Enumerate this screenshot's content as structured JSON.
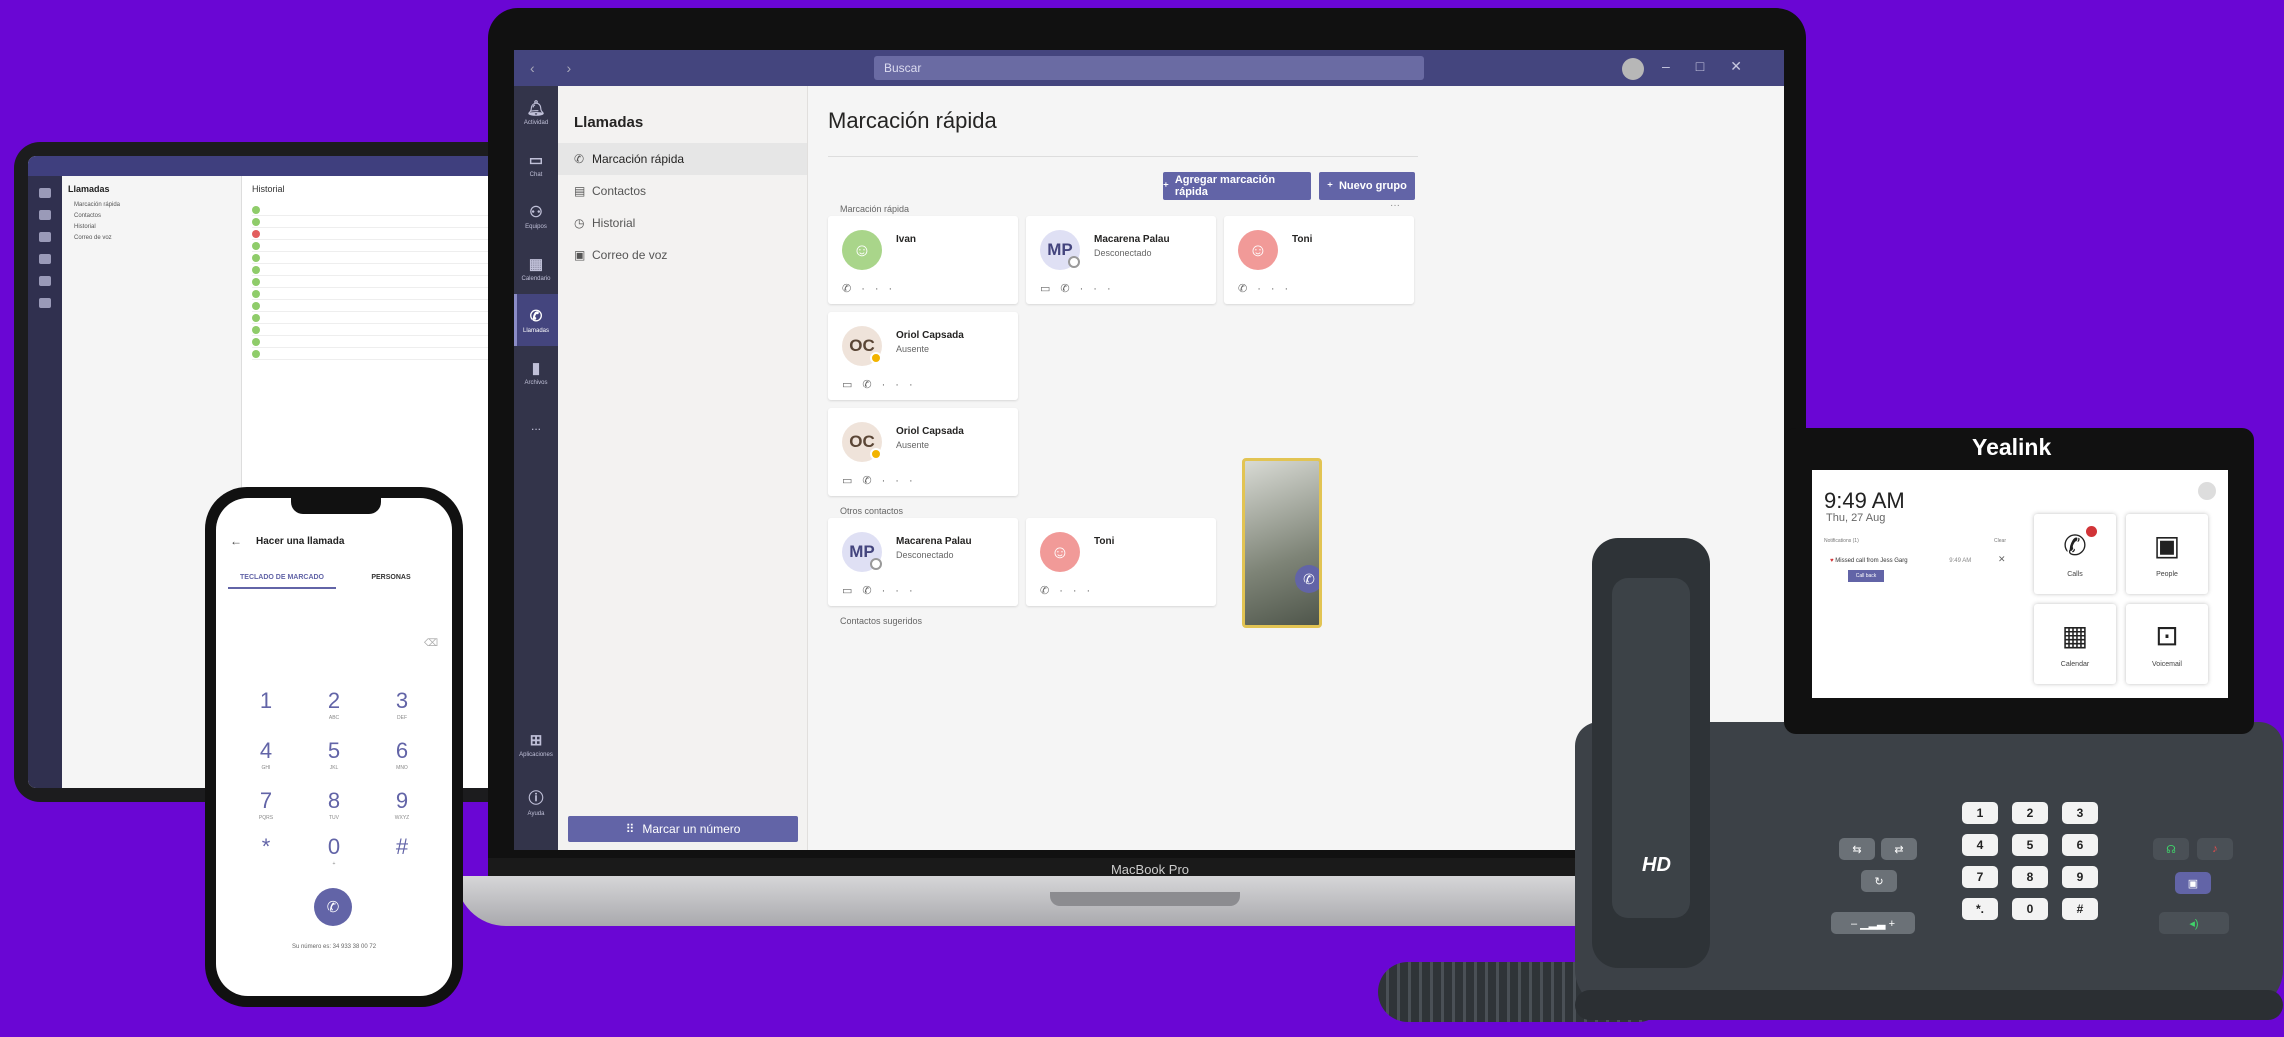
{
  "tablet": {
    "left_title": "Llamadas",
    "left_items": [
      "Marcación rápida",
      "Contactos",
      "Historial",
      "Correo de voz"
    ],
    "main_title": "Historial",
    "rows": 13
  },
  "laptop": {
    "search_placeholder": "Buscar",
    "model_label": "MacBook Pro",
    "rail": [
      {
        "label": "Actividad"
      },
      {
        "label": "Chat"
      },
      {
        "label": "Equipos"
      },
      {
        "label": "Calendario"
      },
      {
        "label": "Llamadas"
      },
      {
        "label": "Archivos"
      },
      {
        "label": "..."
      },
      {
        "label": "Aplicaciones"
      },
      {
        "label": "Ayuda"
      }
    ],
    "left_title": "Llamadas",
    "left_items": [
      {
        "icon": "✆",
        "label": "Marcación rápida"
      },
      {
        "icon": "▤",
        "label": "Contactos"
      },
      {
        "icon": "◷",
        "label": "Historial"
      },
      {
        "icon": "▣",
        "label": "Correo de voz"
      }
    ],
    "dial_button": "Marcar un número",
    "main_title": "Marcación rápida",
    "add_speed_dial": "Agregar marcación rápida",
    "new_group": "Nuevo grupo",
    "section_speed": "Marcación rápida",
    "section_others": "Otros contactos",
    "section_suggested": "Contactos sugeridos",
    "cards": [
      {
        "name": "Ivan",
        "status": "",
        "initials": ""
      },
      {
        "name": "Macarena Palau",
        "status": "Desconectado",
        "initials": "MP"
      },
      {
        "name": "Toni",
        "status": "",
        "initials": ""
      },
      {
        "name": "Oriol Capsada",
        "status": "Ausente",
        "initials": "OC"
      },
      {
        "name": "Oriol Capsada",
        "status": "Ausente",
        "initials": "OC"
      },
      {
        "name": "Macarena Palau",
        "status": "Desconectado",
        "initials": "MP"
      },
      {
        "name": "Toni",
        "status": "",
        "initials": ""
      }
    ]
  },
  "phone": {
    "title": "Hacer una llamada",
    "tab_a": "TECLADO DE MARCADO",
    "tab_b": "PERSONAS",
    "keys": [
      {
        "d": "1",
        "s": ""
      },
      {
        "d": "2",
        "s": "ABC"
      },
      {
        "d": "3",
        "s": "DEF"
      },
      {
        "d": "4",
        "s": "GHI"
      },
      {
        "d": "5",
        "s": "JKL"
      },
      {
        "d": "6",
        "s": "MNO"
      },
      {
        "d": "7",
        "s": "PQRS"
      },
      {
        "d": "8",
        "s": "TUV"
      },
      {
        "d": "9",
        "s": "WXYZ"
      },
      {
        "d": "*",
        "s": ""
      },
      {
        "d": "0",
        "s": "+"
      },
      {
        "d": "#",
        "s": ""
      }
    ],
    "footer": "Su número es: 34 933 38 00 72"
  },
  "desk": {
    "brand": "Yealink",
    "hd": "HD",
    "time": "9:49 AM",
    "date": "Thu, 27 Aug",
    "notif": "Notifications (1)",
    "notif_clear": "Clear",
    "missed": "Missed call from Jess Garg",
    "missed_time": "9:49 AM",
    "callback": "Call back",
    "tiles": [
      {
        "g": "✆",
        "label": "Calls"
      },
      {
        "g": "▣",
        "label": "People"
      },
      {
        "g": "▦",
        "label": "Calendar"
      },
      {
        "g": "⊡",
        "label": "Voicemail"
      }
    ],
    "keys": [
      {
        "d": "1"
      },
      {
        "d": "2"
      },
      {
        "d": "3"
      },
      {
        "d": "4"
      },
      {
        "d": "5"
      },
      {
        "d": "6"
      },
      {
        "d": "7"
      },
      {
        "d": "8"
      },
      {
        "d": "9"
      },
      {
        "d": "*."
      },
      {
        "d": "0"
      },
      {
        "d": "#"
      }
    ]
  }
}
